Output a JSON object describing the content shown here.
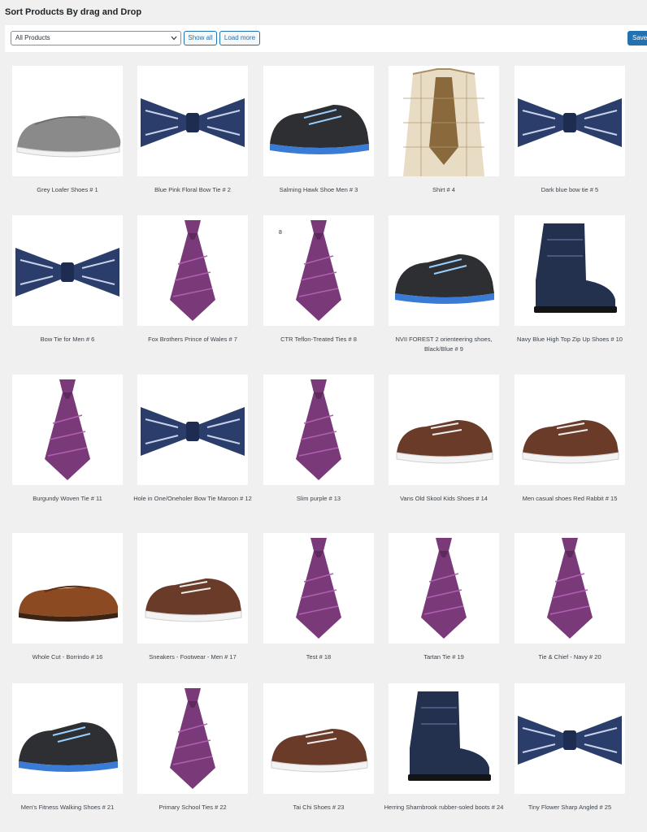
{
  "page": {
    "title": "Sort Products By drag and Drop"
  },
  "toolbar": {
    "filter_value": "All Products",
    "show_all_label": "Show all",
    "load_more_label": "Load more",
    "save_label": "Save"
  },
  "products": [
    {
      "name": "Grey Loafer Shoes # 1",
      "icon": "loafer-shoe"
    },
    {
      "name": "Blue Pink Floral Bow Tie # 2",
      "icon": "bow-tie"
    },
    {
      "name": "Salming Hawk Shoe Men # 3",
      "icon": "sport-shoe"
    },
    {
      "name": "Shirt # 4",
      "icon": "shirt"
    },
    {
      "name": "Dark blue bow tie # 5",
      "icon": "bow-tie"
    },
    {
      "name": "Bow Tie for Men # 6",
      "icon": "bow-tie"
    },
    {
      "name": "Fox Brothers Prince of Wales # 7",
      "icon": "tie"
    },
    {
      "name": "CTR Teflon-Treated Ties # 8",
      "icon": "tie",
      "tag": "8"
    },
    {
      "name": "NVII FOREST 2 orienteering shoes, Black/Blue # 9",
      "icon": "sport-shoe"
    },
    {
      "name": "Navy Blue High Top Zip Up Shoes # 10",
      "icon": "boot"
    },
    {
      "name": "Burgundy Woven Tie # 11",
      "icon": "tie"
    },
    {
      "name": "Hole in One/Oneholer Bow Tie Maroon # 12",
      "icon": "bow-tie"
    },
    {
      "name": "Slim purple # 13",
      "icon": "tie"
    },
    {
      "name": "Vans Old Skool Kids Shoes # 14",
      "icon": "sneaker"
    },
    {
      "name": "Men casual shoes Red Rabbit # 15",
      "icon": "sneaker"
    },
    {
      "name": "Whole Cut - Borrindo # 16",
      "icon": "dress-shoe"
    },
    {
      "name": "Sneakers - Footwear - Men # 17",
      "icon": "sneaker"
    },
    {
      "name": "Test # 18",
      "icon": "tie"
    },
    {
      "name": "Tartan Tie # 19",
      "icon": "tie"
    },
    {
      "name": "Tie & Chief - Navy # 20",
      "icon": "tie"
    },
    {
      "name": "Men's Fitness Walking Shoes # 21",
      "icon": "sport-shoe"
    },
    {
      "name": "Primary School Ties # 22",
      "icon": "tie"
    },
    {
      "name": "Tai Chi Shoes # 23",
      "icon": "sneaker"
    },
    {
      "name": "Herring Sharnbrook rubber-soled boots # 24",
      "icon": "boot"
    },
    {
      "name": "Tiny Flower Sharp Angled # 25",
      "icon": "bow-tie"
    }
  ],
  "colors": {
    "accent": "#2271b1",
    "background": "#f0f0f1",
    "card": "#ffffff"
  }
}
